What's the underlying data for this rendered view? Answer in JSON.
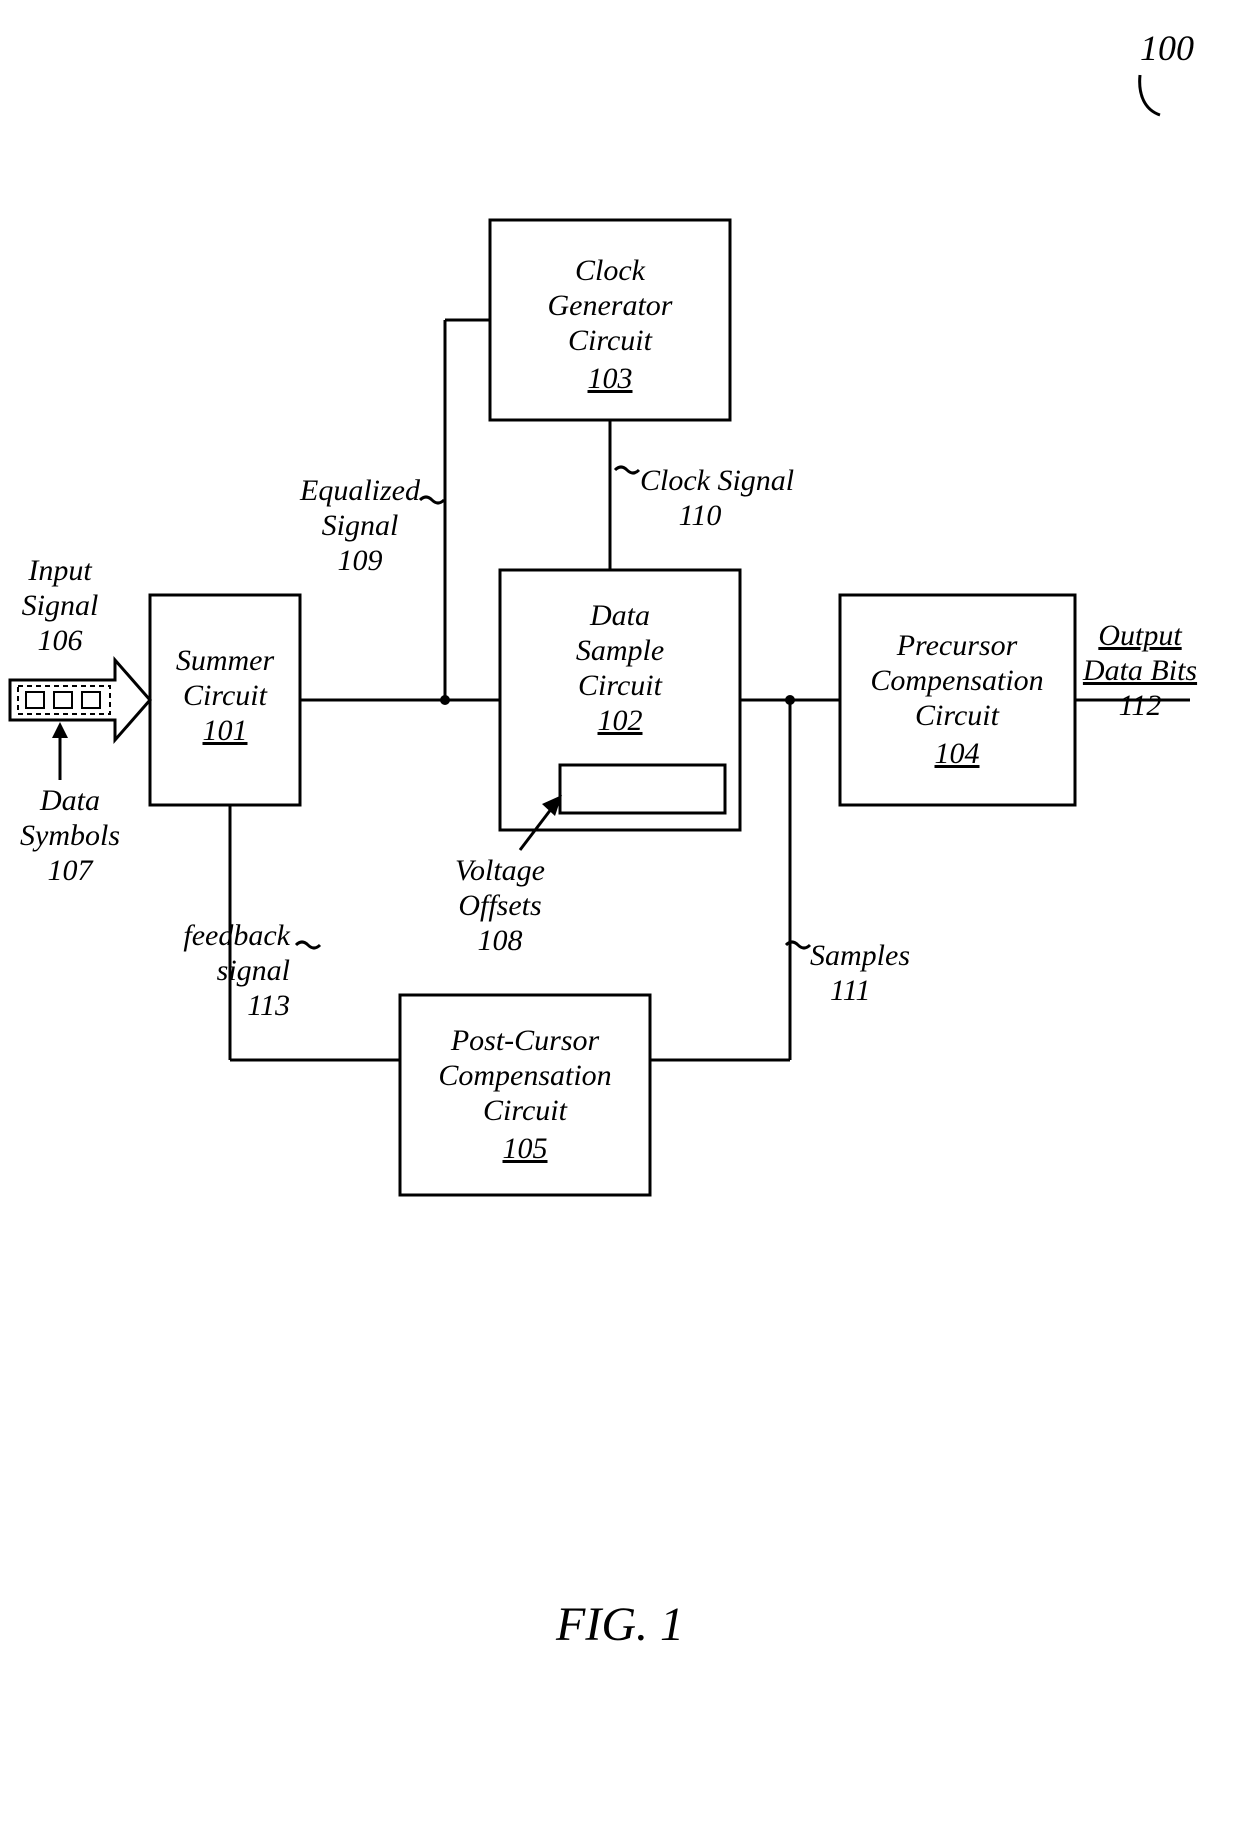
{
  "figure_ref": "100",
  "caption": "FIG. 1",
  "blocks": {
    "summer": {
      "line1": "Summer",
      "line2": "Circuit",
      "ref": "101"
    },
    "clock": {
      "line1": "Clock",
      "line2": "Generator",
      "line3": "Circuit",
      "ref": "103"
    },
    "sample": {
      "line1": "Data",
      "line2": "Sample",
      "line3": "Circuit",
      "ref": "102"
    },
    "pre": {
      "line1": "Precursor",
      "line2": "Compensation",
      "line3": "Circuit",
      "ref": "104"
    },
    "post": {
      "line1": "Post-Cursor",
      "line2": "Compensation",
      "line3": "Circuit",
      "ref": "105"
    }
  },
  "labels": {
    "input_signal": {
      "line1": "Input",
      "line2": "Signal",
      "ref": "106"
    },
    "data_symbols": {
      "line1": "Data",
      "line2": "Symbols",
      "ref": "107"
    },
    "equalized": {
      "line1": "Equalized",
      "line2": "Signal",
      "ref": "109"
    },
    "clock_signal": {
      "line1": "Clock Signal",
      "ref": "110"
    },
    "voltage_offsets": {
      "line1": "Voltage",
      "line2": "Offsets",
      "ref": "108"
    },
    "feedback": {
      "line1": "feedback",
      "line2": "signal",
      "ref": "113"
    },
    "samples": {
      "line1": "Samples",
      "ref": "111"
    },
    "output": {
      "line1": "Output",
      "line2": "Data Bits",
      "ref": "112"
    }
  }
}
